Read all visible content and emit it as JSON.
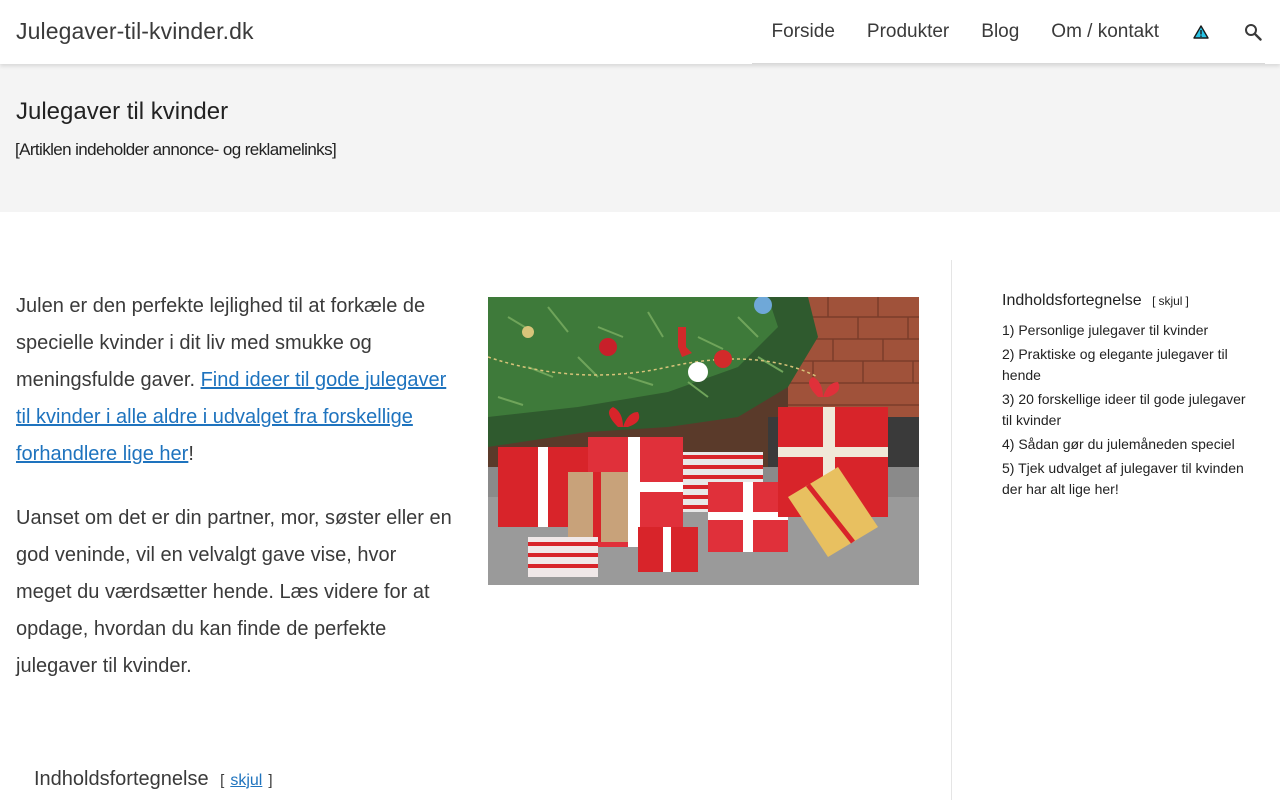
{
  "header": {
    "site_title": "Julegaver-til-kvinder.dk",
    "nav": [
      "Forside",
      "Produkter",
      "Blog",
      "Om / kontakt"
    ],
    "icons": [
      "warning-icon",
      "search-icon"
    ]
  },
  "title_band": {
    "title": "Julegaver til kvinder",
    "disclaimer": "[Artiklen indeholder annonce- og reklamelinks]"
  },
  "intro": {
    "p1_text": "Julen er den perfekte lejlighed til at forkæle de specielle kvinder i dit liv med smukke og meningsfulde gaver. ",
    "p1_link": "Find ideer til gode julegaver til kvinder i alle aldre i udvalget fra forskellige forhandlere lige her",
    "p1_end": "!",
    "p2": "Uanset om det er din partner, mor, søster eller en god veninde, vil en velvalgt gave vise, hvor meget du værdsætter hende. Læs videre for at opdage, hvordan du kan finde de perfekte julegaver til kvinder."
  },
  "toc_bottom": {
    "heading": "Indholdsfortegnelse",
    "open": "[",
    "toggle": "skjul",
    "close": "]"
  },
  "sidebar_toc": {
    "heading": "Indholdsfortegnelse",
    "open": "[",
    "toggle": "skjul",
    "close": "]",
    "items": [
      "1) Personlige julegaver til kvinder",
      "2) Praktiske og elegante julegaver til hende",
      "3) 20 forskellige ideer til gode julegaver til kvinder",
      "4) Sådan gør du julemåneden speciel",
      "5) Tjek udvalget af julegaver til kvinden der har alt lige her!"
    ]
  },
  "colors": {
    "link": "#1e73be",
    "text": "#3a3a3a",
    "band": "#f4f4f4"
  }
}
